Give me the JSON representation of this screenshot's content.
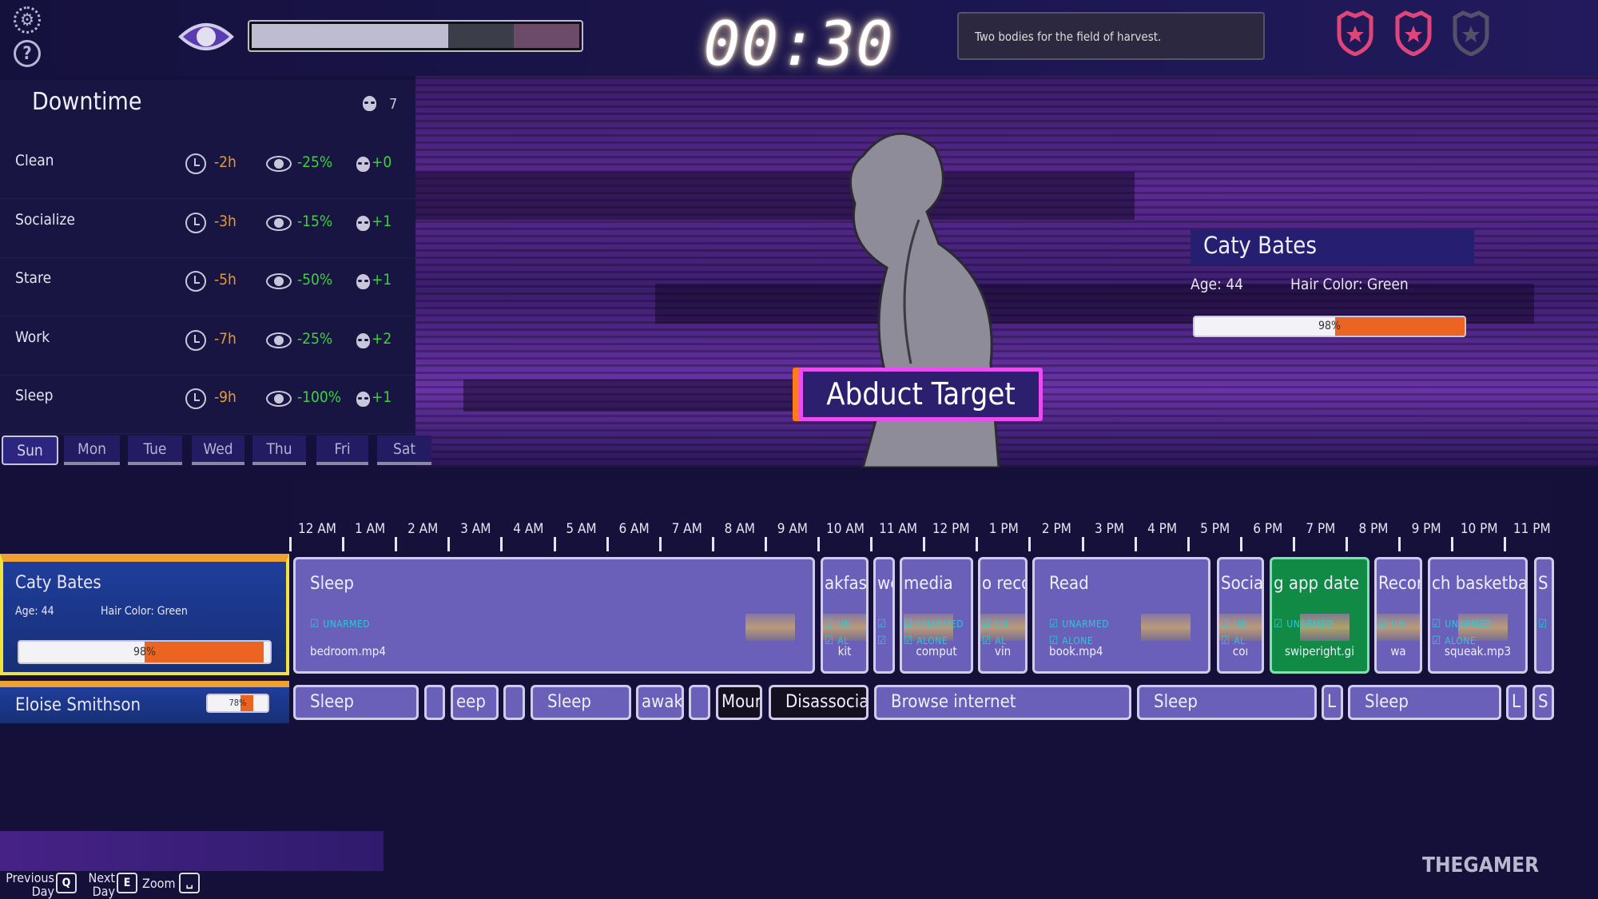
{
  "hud": {
    "clock": "00:30",
    "message": "Two bodies for the field of harvest.",
    "settings_icon": "gear-icon",
    "help_icon": "question-icon",
    "suspicion_icon": "eye-icon",
    "police_badges": {
      "total": 3,
      "active": 2,
      "active_color": "#e0457a",
      "inactive_color": "#55506a"
    },
    "meter": {
      "filled_fraction": 0.6,
      "segments": [
        "#bdbcd0",
        "#3b3d48",
        "#6b4a6a"
      ]
    }
  },
  "downtime": {
    "title": "Downtime",
    "skull_count": "7",
    "rows": [
      {
        "label": "Clean",
        "time": "-2h",
        "visibility": "-25%",
        "skull": "+0"
      },
      {
        "label": "Socialize",
        "time": "-3h",
        "visibility": "-15%",
        "skull": "+1"
      },
      {
        "label": "Stare",
        "time": "-5h",
        "visibility": "-50%",
        "skull": "+1"
      },
      {
        "label": "Work",
        "time": "-7h",
        "visibility": "-25%",
        "skull": "+2"
      },
      {
        "label": "Sleep",
        "time": "-9h",
        "visibility": "-100%",
        "skull": "+1"
      }
    ]
  },
  "days": [
    "Sun",
    "Mon",
    "Tue",
    "Wed",
    "Thu",
    "Fri",
    "Sat"
  ],
  "selected_day": "Sun",
  "action": {
    "label": "Abduct Target"
  },
  "target": {
    "name": "Caty Bates",
    "age": "Age: 44",
    "hair": "Hair Color: Green",
    "progress": 98,
    "progress_label": "98%"
  },
  "timeline": {
    "hours": [
      "12 AM",
      "1 AM",
      "2 AM",
      "3 AM",
      "4 AM",
      "5 AM",
      "6 AM",
      "7 AM",
      "8 AM",
      "9 AM",
      "10 AM",
      "11 AM",
      "12 PM",
      "1 PM",
      "2 PM",
      "3 PM",
      "4 PM",
      "5 PM",
      "6 PM",
      "7 PM",
      "8 PM",
      "9 PM",
      "10 PM",
      "11 PM"
    ],
    "people": [
      {
        "name": "Caty Bates",
        "age": "Age: 44",
        "hair": "Hair Color: Green",
        "progress": 98,
        "progress_label": "98%",
        "selected": true
      },
      {
        "name": "Eloise Smithson",
        "progress": 78,
        "progress_label": "78%"
      }
    ],
    "row1": [
      {
        "title": "Sleep",
        "tags": [
          "UNARMED"
        ],
        "file": "bedroom.mp4",
        "thumb": true
      },
      {
        "title": "akfast",
        "tags": [
          "UN",
          "AL"
        ],
        "file": "kit",
        "thumb": true
      },
      {
        "title": "wel",
        "tags": [
          "",
          ""
        ],
        "file": ""
      },
      {
        "title": "media",
        "tags": [
          "UNARMED",
          "ALONE"
        ],
        "file": "comput",
        "thumb": true
      },
      {
        "title": "o recor",
        "tags": [
          "UN",
          "AL"
        ],
        "file": "vin",
        "thumb": true
      },
      {
        "title": "Read",
        "tags": [
          "UNARMED",
          "ALONE"
        ],
        "file": "book.mp4",
        "thumb": true
      },
      {
        "title": "Socia",
        "tags": [
          "UN",
          "AL"
        ],
        "file": "coı",
        "thumb": true
      },
      {
        "title": "g app date",
        "tags": [
          "UNARMED"
        ],
        "file": "swiperight.gi",
        "thumb": true,
        "highlight": "green"
      },
      {
        "title": "Recor",
        "tags": [
          "UN"
        ],
        "file": "wa",
        "thumb": true
      },
      {
        "title": "ch basketbal",
        "tags": [
          "UNARMED",
          "ALONE"
        ],
        "file": "squeak.mp3",
        "thumb": true
      },
      {
        "title": "S",
        "tags": [
          ""
        ],
        "file": ""
      }
    ],
    "row2": [
      {
        "title": "Sleep"
      },
      {
        "title": ""
      },
      {
        "title": "eep"
      },
      {
        "title": ""
      },
      {
        "title": "Sleep"
      },
      {
        "title": "awake"
      },
      {
        "title": ""
      },
      {
        "title": "Mourn",
        "dark": true
      },
      {
        "title": "Disassociate",
        "dark": true
      },
      {
        "title": "Browse internet"
      },
      {
        "title": "Sleep"
      },
      {
        "title": "L"
      },
      {
        "title": "Sleep"
      },
      {
        "title": "L"
      },
      {
        "title": "S"
      }
    ]
  },
  "controls": {
    "previous": "Previous Day",
    "previous_key": "Q",
    "next": "Next Day",
    "next_key": "E",
    "zoom": "Zoom",
    "zoom_key": "␣"
  },
  "watermark": "THEGAMER"
}
